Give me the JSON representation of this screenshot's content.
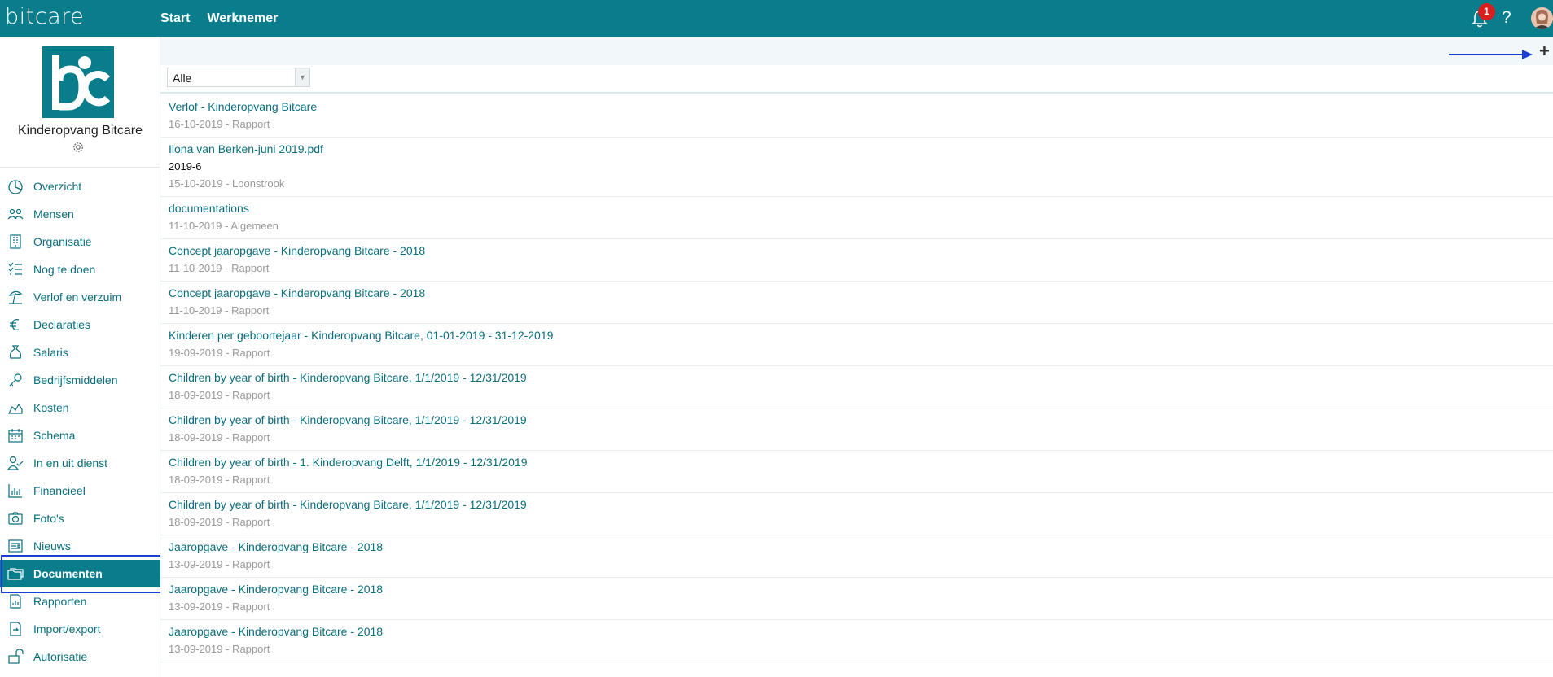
{
  "header": {
    "brand": "bitcare",
    "nav": [
      "Start",
      "Werknemer"
    ],
    "notification_count": "1",
    "help_label": "?"
  },
  "sidebar": {
    "org_name": "Kinderopvang Bitcare",
    "items": [
      {
        "label": "Overzicht",
        "icon": "pie-chart-icon"
      },
      {
        "label": "Mensen",
        "icon": "people-icon"
      },
      {
        "label": "Organisatie",
        "icon": "building-icon"
      },
      {
        "label": "Nog te doen",
        "icon": "checklist-icon"
      },
      {
        "label": "Verlof en verzuim",
        "icon": "beach-icon"
      },
      {
        "label": "Declaraties",
        "icon": "euro-icon"
      },
      {
        "label": "Salaris",
        "icon": "money-bag-icon"
      },
      {
        "label": "Bedrijfsmiddelen",
        "icon": "key-icon"
      },
      {
        "label": "Kosten",
        "icon": "area-chart-icon"
      },
      {
        "label": "Schema",
        "icon": "calendar-icon"
      },
      {
        "label": "In en uit dienst",
        "icon": "person-check-icon"
      },
      {
        "label": "Financieel",
        "icon": "bar-chart-icon"
      },
      {
        "label": "Foto's",
        "icon": "camera-icon"
      },
      {
        "label": "Nieuws",
        "icon": "news-icon"
      },
      {
        "label": "Documenten",
        "icon": "folder-icon",
        "active": true
      },
      {
        "label": "Rapporten",
        "icon": "report-icon"
      },
      {
        "label": "Import/export",
        "icon": "import-export-icon"
      },
      {
        "label": "Autorisatie",
        "icon": "unlock-icon"
      }
    ]
  },
  "main": {
    "add_label": "+",
    "filter": {
      "selected": "Alle"
    },
    "documents": [
      {
        "title": "Verlof - Kinderopvang Bitcare",
        "sub": "",
        "meta": "16-10-2019 - Rapport"
      },
      {
        "title": "Ilona van Berken-juni 2019.pdf",
        "sub": "2019-6",
        "meta": "15-10-2019 - Loonstrook"
      },
      {
        "title": "documentations",
        "sub": "",
        "meta": "11-10-2019 - Algemeen"
      },
      {
        "title": "Concept jaaropgave - Kinderopvang Bitcare - 2018",
        "sub": "",
        "meta": "11-10-2019 - Rapport"
      },
      {
        "title": "Concept jaaropgave - Kinderopvang Bitcare - 2018",
        "sub": "",
        "meta": "11-10-2019 - Rapport"
      },
      {
        "title": "Kinderen per geboortejaar - Kinderopvang Bitcare, 01-01-2019 - 31-12-2019",
        "sub": "",
        "meta": "19-09-2019 - Rapport"
      },
      {
        "title": "Children by year of birth - Kinderopvang Bitcare, 1/1/2019 - 12/31/2019",
        "sub": "",
        "meta": "18-09-2019 - Rapport"
      },
      {
        "title": "Children by year of birth - Kinderopvang Bitcare, 1/1/2019 - 12/31/2019",
        "sub": "",
        "meta": "18-09-2019 - Rapport"
      },
      {
        "title": "Children by year of birth - 1. Kinderopvang Delft, 1/1/2019 - 12/31/2019",
        "sub": "",
        "meta": "18-09-2019 - Rapport"
      },
      {
        "title": "Children by year of birth - Kinderopvang Bitcare, 1/1/2019 - 12/31/2019",
        "sub": "",
        "meta": "18-09-2019 - Rapport"
      },
      {
        "title": "Jaaropgave - Kinderopvang Bitcare - 2018",
        "sub": "",
        "meta": "13-09-2019 - Rapport"
      },
      {
        "title": "Jaaropgave - Kinderopvang Bitcare - 2018",
        "sub": "",
        "meta": "13-09-2019 - Rapport"
      },
      {
        "title": "Jaaropgave - Kinderopvang Bitcare - 2018",
        "sub": "",
        "meta": "13-09-2019 - Rapport"
      }
    ]
  },
  "colors": {
    "brand": "#0a7d8c",
    "link": "#0a6f7e",
    "highlight": "#1a3fd6",
    "badge": "#d81e1e"
  }
}
